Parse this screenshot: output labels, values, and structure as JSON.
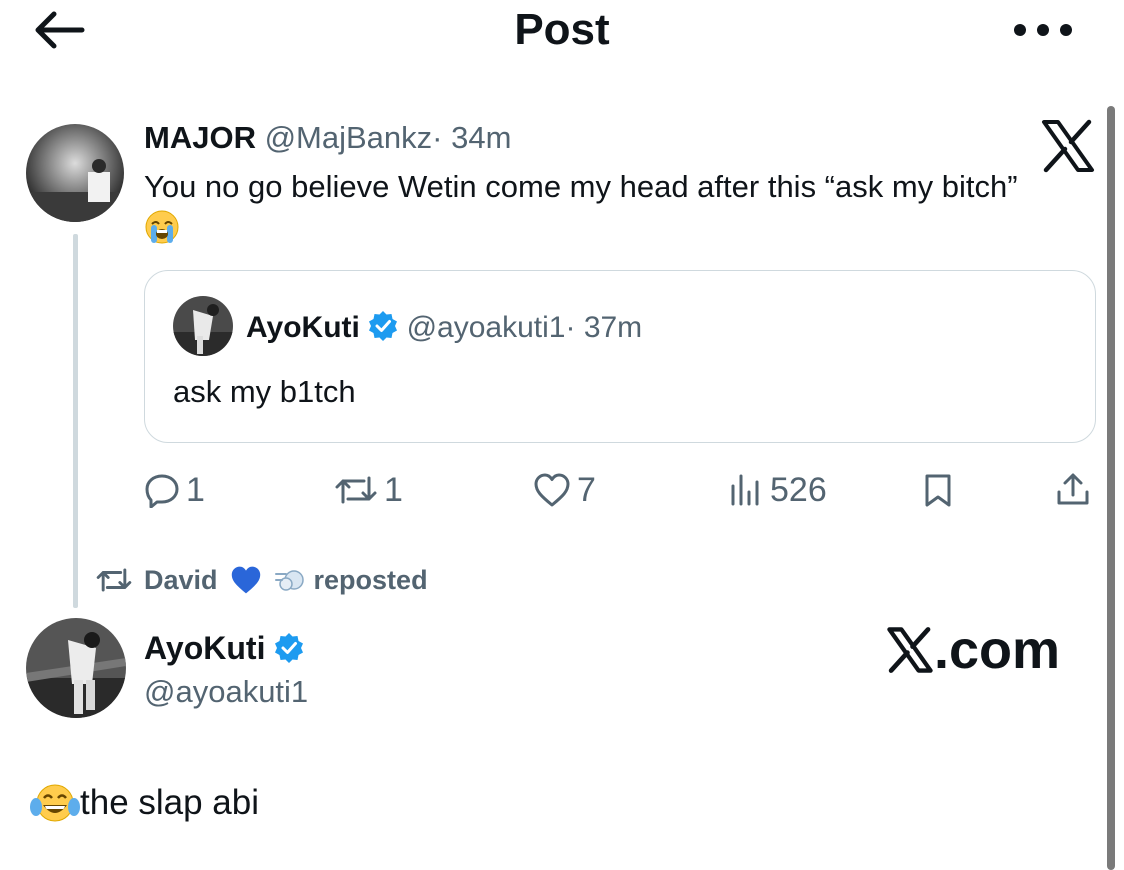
{
  "header": {
    "title": "Post",
    "back_icon": "arrow-left-icon",
    "more_icon": "more-horizontal-icon"
  },
  "tweet1": {
    "author_name": "MAJOR",
    "handle": "@MajBankz",
    "separator": "·",
    "time": "34m",
    "text": "You no go believe Wetin come my head after this “ask my bitch”",
    "emoji": "loudly-crying-face",
    "quoted": {
      "author_name": "AyoKuti",
      "verified": true,
      "handle": "@ayoakuti1",
      "time": "37m",
      "text": "ask my b1tch"
    },
    "actions": {
      "replies": "1",
      "reposts": "1",
      "likes": "7",
      "views": "526"
    }
  },
  "repost_context": {
    "user": "David",
    "suffix": "reposted",
    "emojis": [
      "blue-heart",
      "dashing-away"
    ]
  },
  "tweet2": {
    "author_name": "AyoKuti",
    "verified": true,
    "handle": "@ayoakuti1",
    "text": "the slap abi",
    "emoji": "face-with-tears-of-joy"
  },
  "watermark": {
    "text": ".com"
  },
  "colors": {
    "verified": "#1d9bf0",
    "muted": "#536471",
    "border": "#cfd9de",
    "heart_blue": "#2a66d9"
  }
}
